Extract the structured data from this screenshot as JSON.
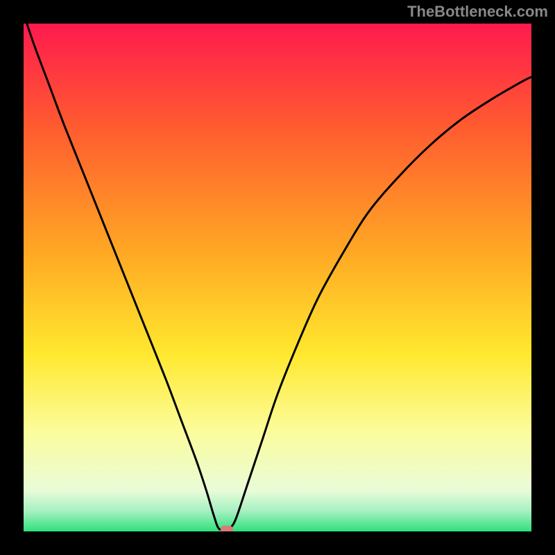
{
  "watermark": "TheBottleneck.com",
  "chart_data": {
    "type": "line",
    "title": "",
    "xlabel": "",
    "ylabel": "",
    "xlim": [
      0,
      100
    ],
    "ylim": [
      0,
      100
    ],
    "background": {
      "type": "vertical-gradient",
      "description": "red at top through orange/yellow to green at bottom",
      "stops": [
        {
          "offset": 0,
          "color": "#FF1A4E"
        },
        {
          "offset": 20,
          "color": "#FF5A30"
        },
        {
          "offset": 45,
          "color": "#FFA824"
        },
        {
          "offset": 65,
          "color": "#FFE82E"
        },
        {
          "offset": 80,
          "color": "#FCFC9A"
        },
        {
          "offset": 92,
          "color": "#E8FCD8"
        },
        {
          "offset": 96,
          "color": "#A6F0C2"
        },
        {
          "offset": 100,
          "color": "#2FE07C"
        }
      ]
    },
    "curve": {
      "description": "V-shaped bottleneck curve: steep descent from top-left, flat bottom around x≈38-40, curved rise toward right",
      "x": [
        0,
        2,
        5,
        8,
        12,
        16,
        20,
        24,
        28,
        31,
        34,
        36,
        37.5,
        38.5,
        40,
        41,
        42,
        44,
        47,
        50,
        54,
        58,
        63,
        68,
        74,
        80,
        86,
        92,
        98,
        100
      ],
      "y": [
        102,
        96,
        88,
        80,
        70,
        60,
        50,
        40,
        30,
        22,
        14,
        8,
        3,
        0.5,
        0.5,
        1,
        3,
        9,
        18,
        27,
        37,
        46,
        55,
        63,
        70,
        76,
        81,
        85,
        88.5,
        89.5
      ]
    },
    "marker": {
      "x": 40,
      "y": 0.3,
      "color": "#D87A7A",
      "shape": "rounded-rect"
    },
    "frame": {
      "stroke": "#000000",
      "strokeWidth": 34
    }
  }
}
